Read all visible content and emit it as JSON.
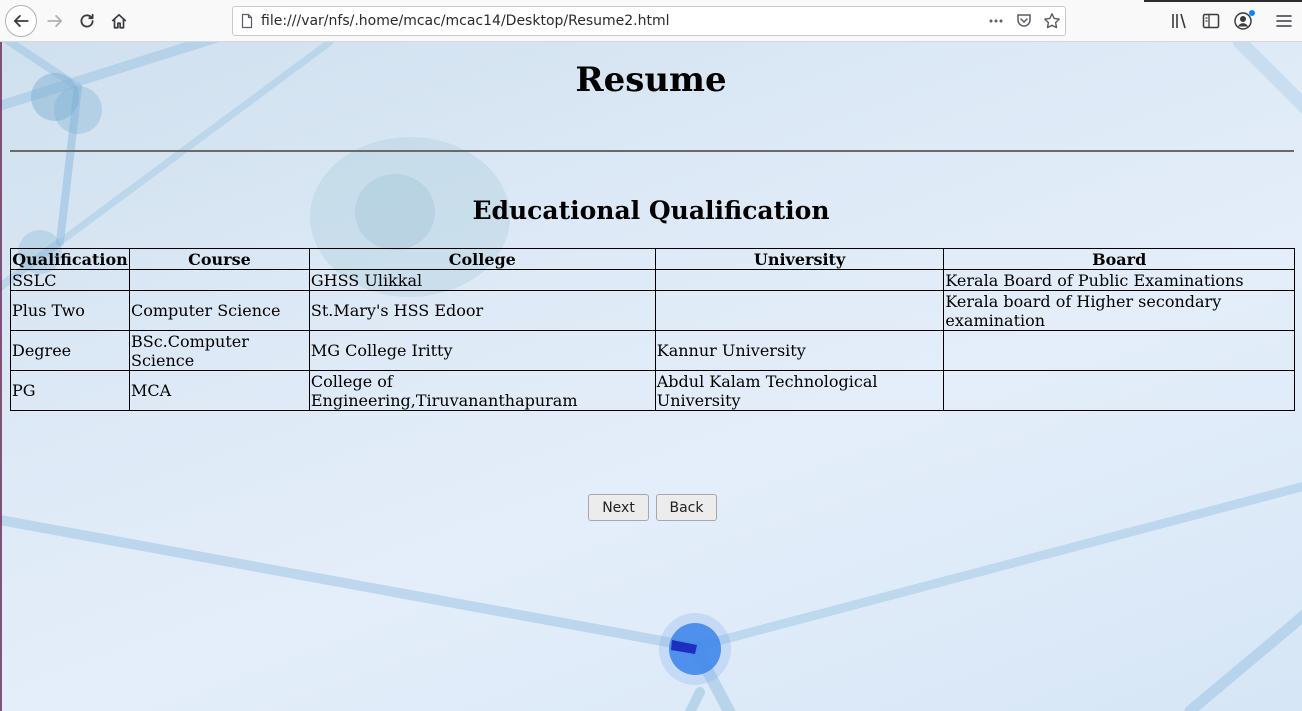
{
  "browser": {
    "url": "file:///var/nfs/.home/mcac/mcac14/Desktop/Resume2.html",
    "icons": [
      "back-icon",
      "forward-icon",
      "reload-icon",
      "home-icon",
      "page-icon",
      "more-icon",
      "pocket-icon",
      "star-icon",
      "library-icon",
      "sidebar-icon",
      "account-icon",
      "menu-icon"
    ],
    "accent": "#0a84ff"
  },
  "page": {
    "title": "Resume",
    "section_title": "Educational Qualification",
    "table": {
      "headers": [
        "Qualification",
        "Course",
        "College",
        "University",
        "Board"
      ],
      "rows": [
        [
          "SSLC",
          "",
          "GHSS Ulikkal",
          "",
          "Kerala Board of Public Examinations"
        ],
        [
          "Plus Two",
          "Computer Science",
          "St.Mary's HSS Edoor",
          "",
          "Kerala board of Higher secondary examination"
        ],
        [
          "Degree",
          "BSc.Computer Science",
          "MG College Iritty",
          "Kannur University",
          ""
        ],
        [
          "PG",
          "MCA",
          "College of Engineering,Tiruvananthapuram",
          "Abdul Kalam Technological University",
          ""
        ]
      ]
    },
    "buttons": {
      "next": "Next",
      "back": "Back"
    }
  }
}
